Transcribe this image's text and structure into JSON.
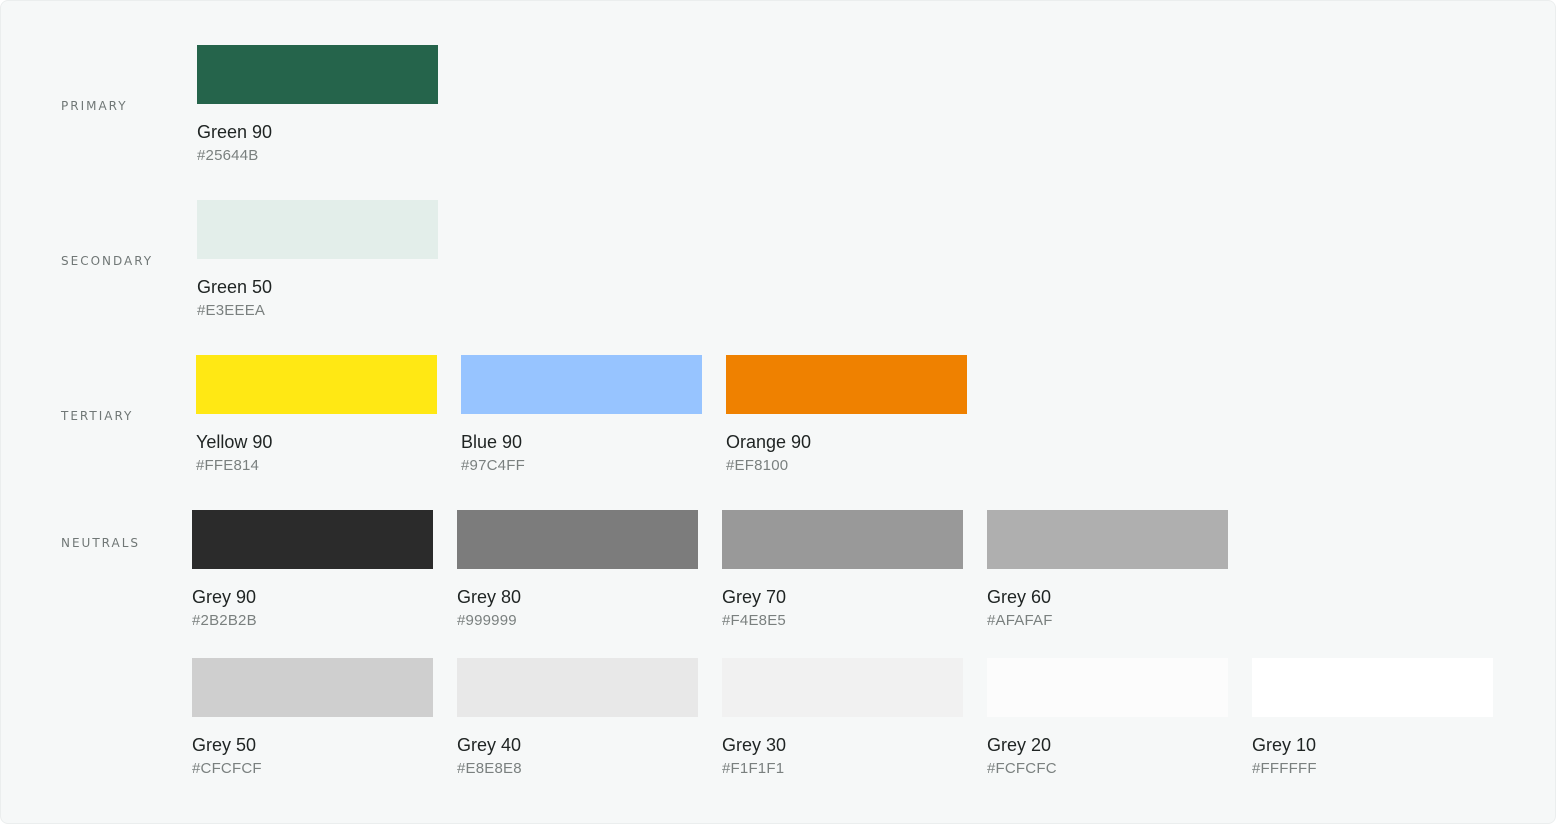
{
  "sections": {
    "primary": "PRIMARY",
    "secondary": "SECONDARY",
    "tertiary": "TERTIARY",
    "neutrals": "NEUTRALS"
  },
  "primary": [
    {
      "name": "Green 90",
      "hex": "#25644B",
      "color": "#25644B"
    }
  ],
  "secondary": [
    {
      "name": "Green 50",
      "hex": "#E3EEEA",
      "color": "#E3EEEA"
    }
  ],
  "tertiary": [
    {
      "name": "Yellow 90",
      "hex": "#FFE814",
      "color": "#FFE814"
    },
    {
      "name": "Blue 90",
      "hex": "#97C4FF",
      "color": "#97C4FF"
    },
    {
      "name": "Orange 90",
      "hex": "#EF8100",
      "color": "#EF8100"
    }
  ],
  "neutrals_row1": [
    {
      "name": "Grey 90",
      "hex": "#2B2B2B",
      "color": "#2B2B2B"
    },
    {
      "name": "Grey 80",
      "hex": "#999999",
      "color": "#7C7C7C"
    },
    {
      "name": "Grey 70",
      "hex": "#F4E8E5",
      "color": "#999999"
    },
    {
      "name": "Grey 60",
      "hex": "#AFAFAF",
      "color": "#AFAFAF"
    }
  ],
  "neutrals_row2": [
    {
      "name": "Grey 50",
      "hex": "#CFCFCF",
      "color": "#CFCFCF"
    },
    {
      "name": "Grey 40",
      "hex": "#E8E8E8",
      "color": "#E8E8E8"
    },
    {
      "name": "Grey 30",
      "hex": "#F1F1F1",
      "color": "#F1F1F1"
    },
    {
      "name": "Grey 20",
      "hex": "#FCFCFC",
      "color": "#FCFCFC"
    },
    {
      "name": "Grey 10",
      "hex": "#FFFFFF",
      "color": "#FFFFFF"
    }
  ]
}
